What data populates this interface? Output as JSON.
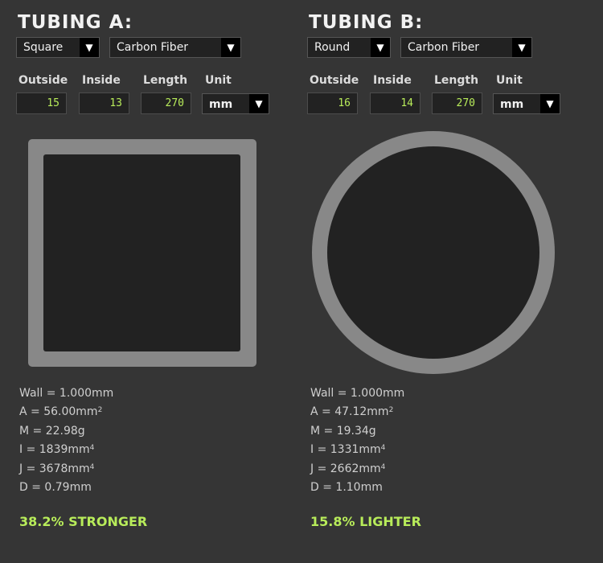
{
  "colors": {
    "background": "#353535",
    "accent_green": "#b8ec5a",
    "tube_wall": "#888888",
    "tube_hollow": "#222222"
  },
  "tubing_a": {
    "title": "TUBING A:",
    "shape": "Square",
    "material": "Carbon Fiber",
    "labels": {
      "outside": "Outside",
      "inside": "Inside",
      "length": "Length",
      "unit": "Unit"
    },
    "outside": "15",
    "inside": "13",
    "length": "270",
    "unit": "mm",
    "arrow_icon": "▼",
    "stats": {
      "wall": "Wall = 1.000mm",
      "area": "A = 56.00mm",
      "area_exp": "2",
      "mass": "M = 22.98g",
      "inertia": "I = 1839mm",
      "inertia_exp": "4",
      "polar": "J = 3678mm",
      "polar_exp": "4",
      "deflection": "D = 0.79mm"
    },
    "verdict": "38.2% STRONGER"
  },
  "tubing_b": {
    "title": "TUBING B:",
    "shape": "Round",
    "material": "Carbon Fiber",
    "labels": {
      "outside": "Outside",
      "inside": "Inside",
      "length": "Length",
      "unit": "Unit"
    },
    "outside": "16",
    "inside": "14",
    "length": "270",
    "unit": "mm",
    "arrow_icon": "▼",
    "stats": {
      "wall": "Wall = 1.000mm",
      "area": "A = 47.12mm",
      "area_exp": "2",
      "mass": "M = 19.34g",
      "inertia": "I = 1331mm",
      "inertia_exp": "4",
      "polar": "J = 2662mm",
      "polar_exp": "4",
      "deflection": "D = 1.10mm"
    },
    "verdict": "15.8% LIGHTER"
  }
}
